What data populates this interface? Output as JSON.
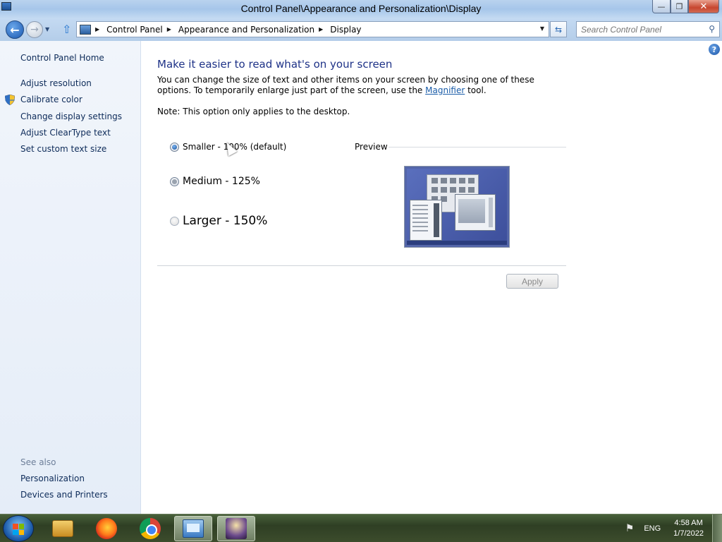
{
  "window": {
    "title": "Control Panel\\Appearance and Personalization\\Display",
    "min_glyph": "—",
    "max_glyph": "❐",
    "close_glyph": "✕"
  },
  "nav": {
    "breadcrumbs": [
      "Control Panel",
      "Appearance and Personalization",
      "Display"
    ],
    "search_placeholder": "Search Control Panel"
  },
  "sidebar": {
    "home": "Control Panel Home",
    "tasks": [
      "Adjust resolution",
      "Calibrate color",
      "Change display settings",
      "Adjust ClearType text",
      "Set custom text size"
    ],
    "see_also_label": "See also",
    "see_also": [
      "Personalization",
      "Devices and Printers"
    ]
  },
  "main": {
    "heading": "Make it easier to read what's on your screen",
    "desc_part1": "You can change the size of text and other items on your screen by choosing one of these options. To temporarily enlarge just part of the screen, use the ",
    "desc_link": "Magnifier",
    "desc_part2": " tool.",
    "note": "Note: This option only applies to the desktop.",
    "options": [
      {
        "label": "Smaller - 100% (default)",
        "selected": true
      },
      {
        "label": "Medium - 125%",
        "selected": false
      },
      {
        "label": "Larger - 150%",
        "selected": false
      }
    ],
    "preview_label": "Preview",
    "apply_label": "Apply",
    "help_glyph": "?"
  },
  "taskbar": {
    "lang": "ENG",
    "time": "4:58 AM",
    "date": "1/7/2022"
  },
  "colors": {
    "link": "#1a5ca8",
    "heading": "#1e3287",
    "sidebar_bg": "#eef3fa"
  }
}
